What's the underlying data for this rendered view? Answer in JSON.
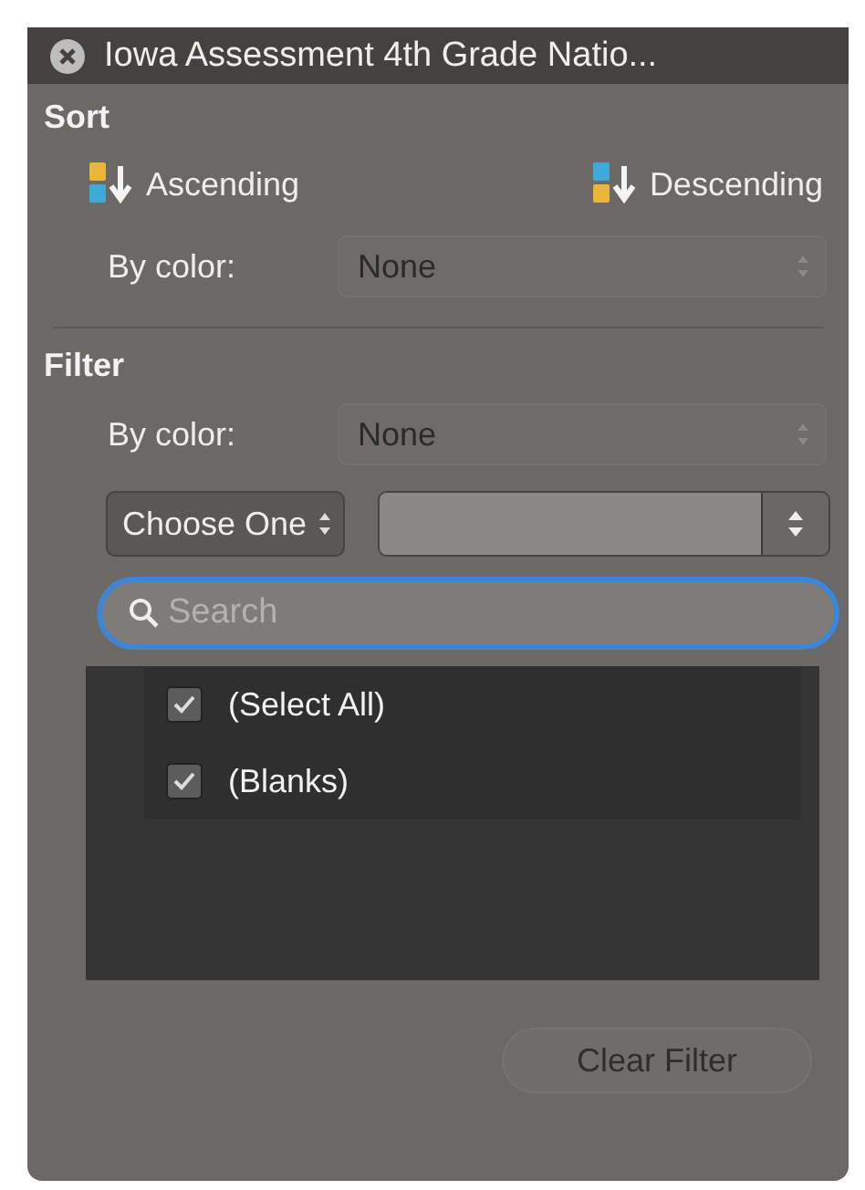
{
  "window": {
    "title": "Iowa Assessment 4th Grade Natio..."
  },
  "sort": {
    "heading": "Sort",
    "buttons": [
      {
        "kind": "ascending",
        "label": "Ascending"
      },
      {
        "kind": "descending",
        "label": "Descending"
      }
    ],
    "by_color": {
      "label": "By color:",
      "value": "None",
      "disabled": true
    }
  },
  "filter": {
    "heading": "Filter",
    "by_color": {
      "label": "By color:",
      "value": "None",
      "disabled": true
    },
    "condition": {
      "value": "Choose One"
    },
    "search": {
      "placeholder": "Search"
    },
    "items": [
      {
        "label": "(Select All)",
        "checked": true
      },
      {
        "label": "(Blanks)",
        "checked": true
      }
    ]
  },
  "clear_button": {
    "label": "Clear Filter",
    "disabled": true
  }
}
